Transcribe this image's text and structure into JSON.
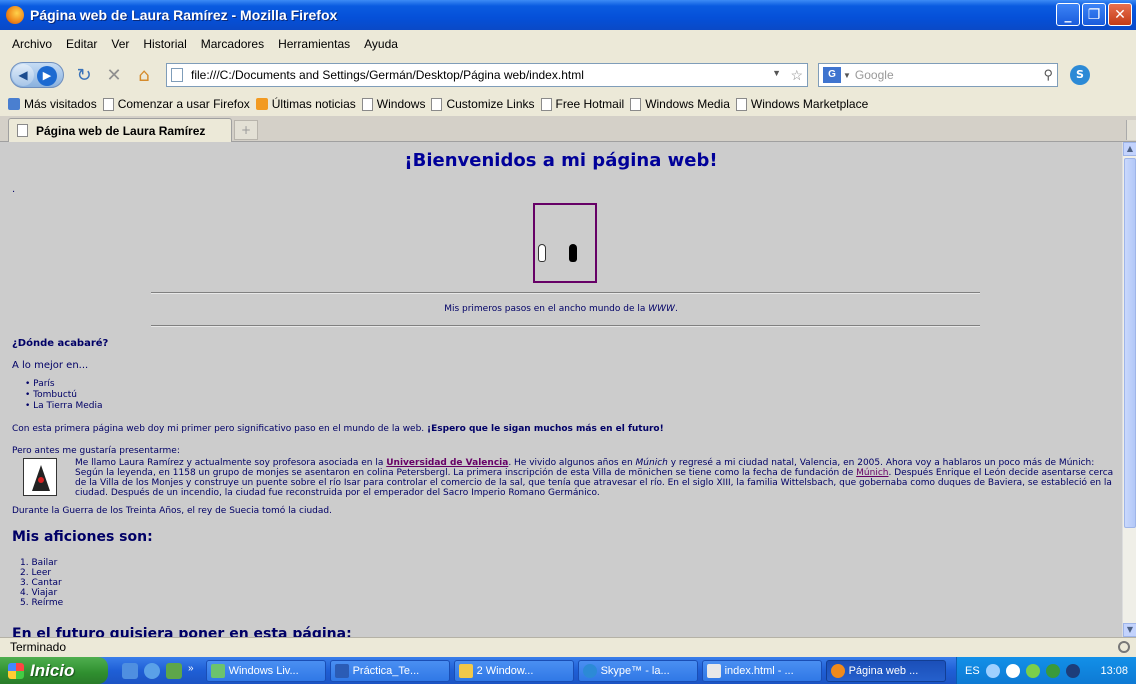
{
  "window": {
    "title": "Página web de Laura Ramírez - Mozilla Firefox"
  },
  "menu": [
    "Archivo",
    "Editar",
    "Ver",
    "Historial",
    "Marcadores",
    "Herramientas",
    "Ayuda"
  ],
  "nav": {
    "url": "file:///C:/Documents and Settings/Germán/Desktop/Página web/index.html",
    "search_placeholder": "Google"
  },
  "bookmarks": [
    "Más visitados",
    "Comenzar a usar Firefox",
    "Últimas noticias",
    "Windows",
    "Customize Links",
    "Free Hotmail",
    "Windows Media",
    "Windows Marketplace"
  ],
  "tab": {
    "label": "Página web de Laura Ramírez"
  },
  "page": {
    "heading": "¡Bienvenidos a mi página web!",
    "dot": ".",
    "tagline_before": "Mis primeros pasos en el ancho mundo de la ",
    "tagline_em": "WWW",
    "tagline_after": ".",
    "question": "¿Dónde acabaré?",
    "maybe": "A lo mejor en...",
    "places": [
      "París",
      "Tombuctú",
      "La Tierra Media"
    ],
    "first_page_text": "Con esta primera página web doy mi primer pero significativo paso en el mundo de la web. ",
    "first_page_bold": "¡Espero que le sigan muchos más en el futuro!",
    "intro": "Pero antes me gustaría presentarme:",
    "bio_1": "Me llamo Laura Ramírez y actualmente soy profesora asociada en la ",
    "bio_univ": "Universidad de Valencia",
    "bio_2": ". He vivido algunos años en ",
    "bio_munich_em": "Múnich",
    "bio_3": " y regresé a mi ciudad natal, Valencia, en 2005. Ahora voy a hablaros un poco más de Múnich: Según la leyenda, en 1158 un grupo de monjes se asentaron en colina Petersbergl. La primera inscripción de esta Villa de mönichen se tiene como la fecha de fundación de ",
    "bio_munich_link": "Múnich",
    "bio_4": ". Después Enrique el León decide asentarse cerca de la Villa de los Monjes y construye un puente sobre el río Isar para controlar el comercio de la sal, que tenía que atravesar el río. En el siglo XIII, la familia Wittelsbach, que gobernaba como duques de Baviera, se estableció en la ciudad. Después de un incendio, la ciudad fue reconstruida por el emperador del Sacro Imperio Romano Germánico.",
    "bio_last": "Durante la Guerra de los Treinta Años, el rey de Suecia tomó la ciudad.",
    "hobbies_heading": "Mis aficiones son:",
    "hobbies": [
      "1. Bailar",
      "2. Leer",
      "3. Cantar",
      "4. Viajar",
      "5. Reírme"
    ],
    "future_heading": "En el futuro quisiera poner en esta página:"
  },
  "status": {
    "text": "Terminado"
  },
  "taskbar": {
    "start": "Inicio",
    "more": "»",
    "buttons": [
      "Windows Liv...",
      "Práctica_Te...",
      "2 Window...",
      "Skype™ - la...",
      "index.html - ...",
      "Página web ..."
    ],
    "lang": "ES",
    "clock": "13:08"
  },
  "colors": {
    "page_bg": "#cccccc",
    "text": "#000066",
    "link": "#660066"
  }
}
